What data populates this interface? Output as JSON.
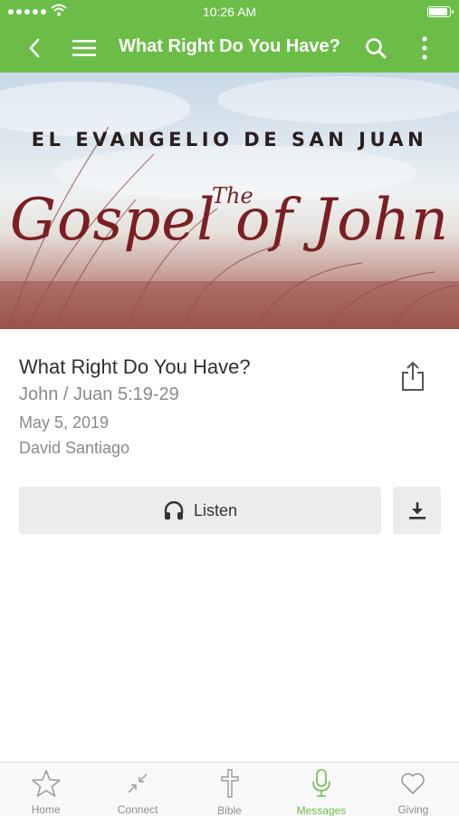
{
  "status_bar": {
    "time": "10:26 AM"
  },
  "nav": {
    "title": "What Right Do You Have?",
    "icons": [
      "back-chevron-icon",
      "menu-icon",
      "search-icon",
      "more-vertical-icon"
    ]
  },
  "hero": {
    "subtitle": "EL EVANGELIO DE SAN JUAN",
    "the": "The",
    "title": "Gospel of John"
  },
  "message": {
    "title": "What Right Do You Have?",
    "scripture": "John / Juan 5:19-29",
    "date": "May 5, 2019",
    "speaker": "David Santiago"
  },
  "actions": {
    "listen_label": "Listen"
  },
  "tabs": [
    {
      "label": "Home",
      "icon": "star-icon"
    },
    {
      "label": "Connect",
      "icon": "connect-arrows-icon"
    },
    {
      "label": "Bible",
      "icon": "cross-icon"
    },
    {
      "label": "Messages",
      "icon": "microphone-icon"
    },
    {
      "label": "Giving",
      "icon": "heart-icon"
    }
  ],
  "colors": {
    "accent": "#6cbd48",
    "hero_title": "#7b1f22",
    "inactive_tab": "#8e8e8e"
  }
}
